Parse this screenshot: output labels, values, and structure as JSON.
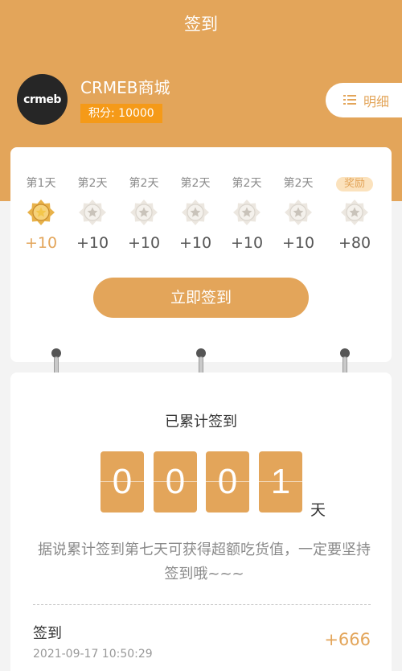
{
  "header": {
    "title": "签到"
  },
  "user": {
    "avatar_text": "crmeb",
    "store_name": "CRMEB商城",
    "points_label": "积分: 10000"
  },
  "detail_button": {
    "label": "明细"
  },
  "days": [
    {
      "label": "第1天",
      "value": "+10",
      "done": true
    },
    {
      "label": "第2天",
      "value": "+10",
      "done": false
    },
    {
      "label": "第2天",
      "value": "+10",
      "done": false
    },
    {
      "label": "第2天",
      "value": "+10",
      "done": false
    },
    {
      "label": "第2天",
      "value": "+10",
      "done": false
    },
    {
      "label": "第2天",
      "value": "+10",
      "done": false
    },
    {
      "label": "奖励",
      "value": "+80",
      "done": false,
      "reward": true
    }
  ],
  "sign_button": {
    "label": "立即签到"
  },
  "total": {
    "label": "已累计签到",
    "digits": [
      "0",
      "0",
      "0",
      "1"
    ],
    "unit": "天",
    "hint": "据说累计签到第七天可获得超额吃货值，一定要坚持签到哦~~~"
  },
  "record": {
    "title": "签到",
    "time": "2021-09-17 10:50:29",
    "value": "+666"
  },
  "colors": {
    "accent": "#e3a55a",
    "points_bg": "#f59a18",
    "background": "#f3f3f3"
  }
}
